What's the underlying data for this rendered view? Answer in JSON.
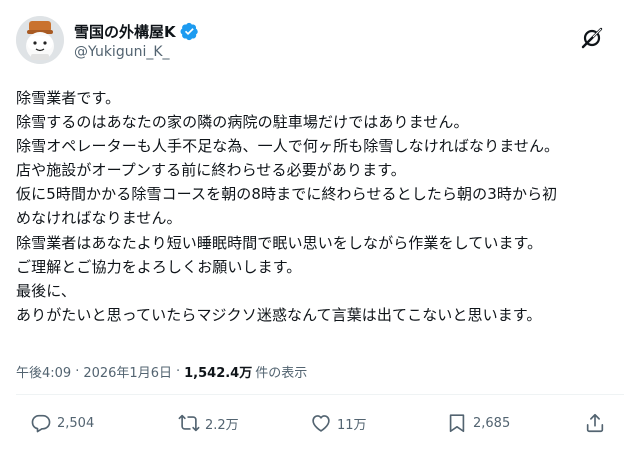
{
  "author": {
    "display_name": "雪国の外構屋K",
    "handle": "@Yukiguni_K_"
  },
  "tweet": {
    "lines": [
      "除雪業者です。",
      "除雪するのはあなたの家の隣の病院の駐車場だけではありません。",
      "除雪オペレーターも人手不足な為、一人で何ヶ所も除雪しなければなりません。",
      "店や施設がオープンする前に終わらせる必要があります。",
      "仮に5時間かかる除雪コースを朝の8時までに終わらせるとしたら朝の3時から初",
      "めなければなりません。",
      "除雪業者はあなたより短い睡眠時間で眠い思いをしながら作業をしています。",
      "ご理解とご協力をよろしくお願いします。",
      "最後に、",
      "ありがたいと思っていたらマジクソ迷惑なんて言葉は出てこないと思います。"
    ]
  },
  "meta": {
    "time": "午後4:09",
    "separator": "·",
    "date": "2026年1月6日",
    "views_count": "1,542.4万",
    "views_label": "件の表示"
  },
  "actions": {
    "replies": "2,504",
    "reposts": "2.2万",
    "likes": "11万",
    "bookmarks": "2,685"
  },
  "icons": [
    "avatar",
    "verified-badge-icon",
    "grok-icon",
    "reply-icon",
    "repost-icon",
    "like-icon",
    "bookmark-icon",
    "share-icon"
  ],
  "colors": {
    "verified": "#1d9bf0",
    "text": "#0f1419",
    "secondary": "#536471"
  }
}
